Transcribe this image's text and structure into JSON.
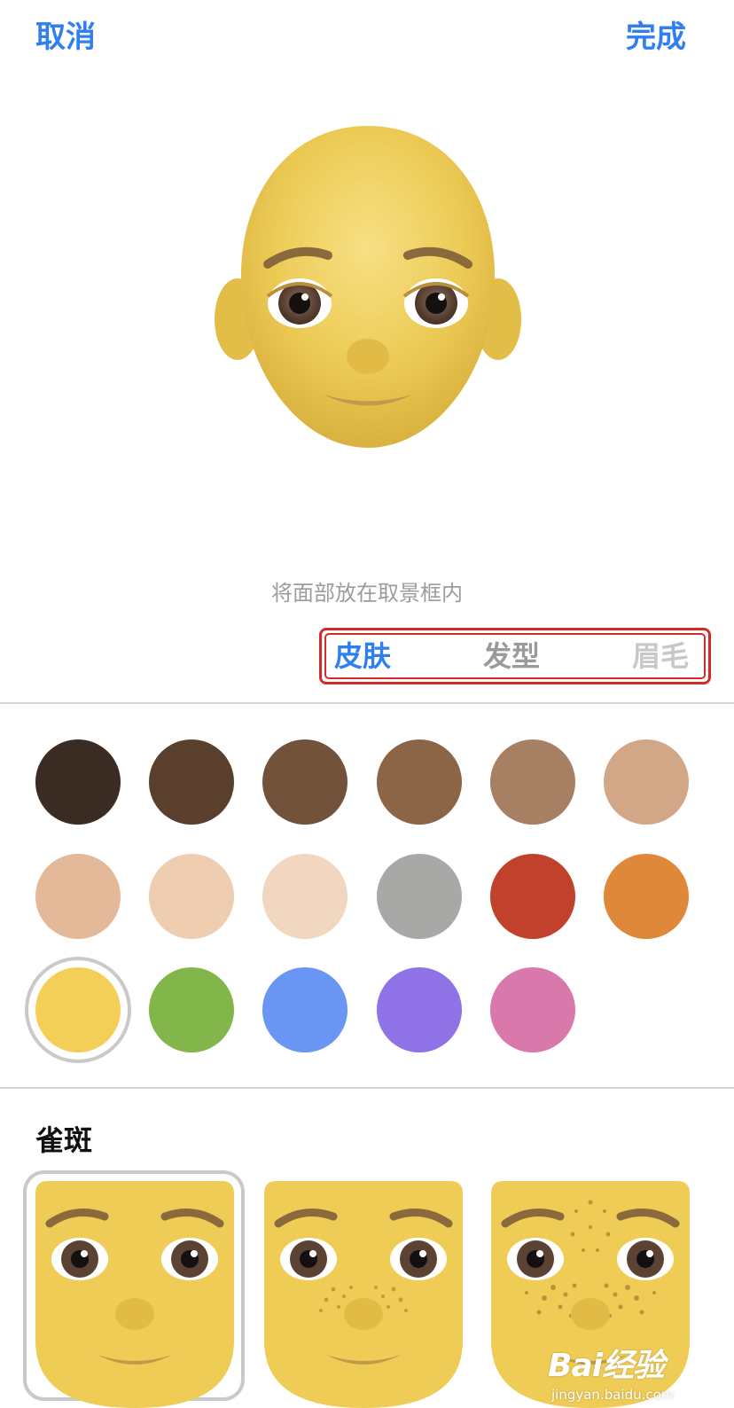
{
  "nav": {
    "cancel_label": "取消",
    "done_label": "完成"
  },
  "hint": "将面部放在取景框内",
  "tabs": [
    {
      "label": "皮肤",
      "active": true
    },
    {
      "label": "发型",
      "active": false
    },
    {
      "label": "眉毛",
      "active": false
    }
  ],
  "skin_colors": [
    {
      "color": "#3a2c23",
      "selected": false
    },
    {
      "color": "#5a3f2c",
      "selected": false
    },
    {
      "color": "#73523b",
      "selected": false
    },
    {
      "color": "#8c6446",
      "selected": false
    },
    {
      "color": "#a77f62",
      "selected": false
    },
    {
      "color": "#d1a787",
      "selected": false
    },
    {
      "color": "#e3b99a",
      "selected": false
    },
    {
      "color": "#eecdb1",
      "selected": false
    },
    {
      "color": "#f2d7c0",
      "selected": false
    },
    {
      "color": "#a8a8a6",
      "selected": false
    },
    {
      "color": "#c2412c",
      "selected": false
    },
    {
      "color": "#e0883a",
      "selected": false
    },
    {
      "color": "#f3cf58",
      "selected": true
    },
    {
      "color": "#82b64a",
      "selected": false
    },
    {
      "color": "#6996f3",
      "selected": false
    },
    {
      "color": "#8f73e6",
      "selected": false
    },
    {
      "color": "#d978ab",
      "selected": false
    }
  ],
  "freckles": {
    "title": "雀斑",
    "options": [
      {
        "icon": "face-no-freckles-icon",
        "selected": true
      },
      {
        "icon": "face-light-freckles-icon",
        "selected": false
      },
      {
        "icon": "face-heavy-freckles-icon",
        "selected": false
      }
    ]
  },
  "colors": {
    "accent": "#2f7ff0",
    "highlight_box": "#d42a2a",
    "face": "#f0cf58"
  },
  "watermark": {
    "brand": "Bai经验",
    "url": "jingyan.baidu.com"
  }
}
